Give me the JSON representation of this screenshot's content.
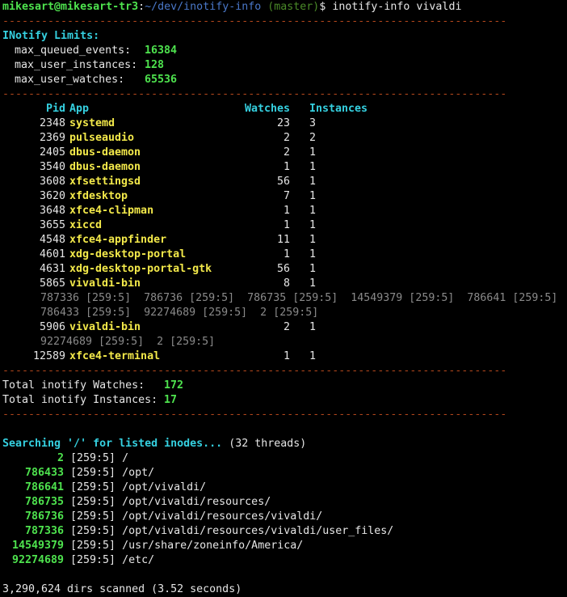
{
  "prompt": {
    "user_host": "mikesart@mikesart-tr3",
    "colon": ":",
    "cwd": "~/dev/inotify-info",
    "branch": "(master)",
    "symbol": "$",
    "command": "inotify-info vivaldi"
  },
  "separator": "------------------------------------------------------------------------------",
  "limits": {
    "title": "INotify Limits:",
    "items": [
      {
        "label": "max_queued_events:",
        "value": "16384"
      },
      {
        "label": "max_user_instances:",
        "value": "128"
      },
      {
        "label": "max_user_watches:",
        "value": "65536"
      }
    ]
  },
  "table": {
    "headers": {
      "pid": "Pid",
      "app": "App",
      "watches": "Watches",
      "instances": "Instances"
    },
    "rows": [
      {
        "pid": "2348",
        "app": "systemd",
        "watches": "23",
        "instances": "3"
      },
      {
        "pid": "2369",
        "app": "pulseaudio",
        "watches": "2",
        "instances": "2"
      },
      {
        "pid": "2405",
        "app": "dbus-daemon",
        "watches": "2",
        "instances": "1"
      },
      {
        "pid": "3540",
        "app": "dbus-daemon",
        "watches": "1",
        "instances": "1"
      },
      {
        "pid": "3608",
        "app": "xfsettingsd",
        "watches": "56",
        "instances": "1"
      },
      {
        "pid": "3620",
        "app": "xfdesktop",
        "watches": "7",
        "instances": "1"
      },
      {
        "pid": "3648",
        "app": "xfce4-clipman",
        "watches": "1",
        "instances": "1"
      },
      {
        "pid": "3655",
        "app": "xiccd",
        "watches": "1",
        "instances": "1"
      },
      {
        "pid": "4548",
        "app": "xfce4-appfinder",
        "watches": "11",
        "instances": "1"
      },
      {
        "pid": "4601",
        "app": "xdg-desktop-portal",
        "watches": "1",
        "instances": "1"
      },
      {
        "pid": "4631",
        "app": "xdg-desktop-portal-gtk",
        "watches": "56",
        "instances": "1"
      },
      {
        "pid": "5865",
        "app": "vivaldi-bin",
        "watches": "8",
        "instances": "1"
      }
    ],
    "vivaldi1_inodes_line1": "787336 [259:5]  786736 [259:5]  786735 [259:5]  14549379 [259:5]  786641 [259:5]",
    "vivaldi1_inodes_line2": "786433 [259:5]  92274689 [259:5]  2 [259:5]",
    "row_5906": {
      "pid": "5906",
      "app": "vivaldi-bin",
      "watches": "2",
      "instances": "1"
    },
    "vivaldi2_inodes_line": "92274689 [259:5]  2 [259:5]",
    "row_12589": {
      "pid": "12589",
      "app": "xfce4-terminal",
      "watches": "1",
      "instances": "1"
    }
  },
  "totals": {
    "watches_label": "Total inotify Watches:",
    "watches_value": "172",
    "instances_label": "Total inotify Instances:",
    "instances_value": "17"
  },
  "search": {
    "title": "Searching '/' for listed inodes...",
    "threads": "(32 threads)",
    "results": [
      {
        "inode": "2",
        "dev": "[259:5]",
        "path": "/"
      },
      {
        "inode": "786433",
        "dev": "[259:5]",
        "path": "/opt/"
      },
      {
        "inode": "786641",
        "dev": "[259:5]",
        "path": "/opt/vivaldi/"
      },
      {
        "inode": "786735",
        "dev": "[259:5]",
        "path": "/opt/vivaldi/resources/"
      },
      {
        "inode": "786736",
        "dev": "[259:5]",
        "path": "/opt/vivaldi/resources/vivaldi/"
      },
      {
        "inode": "787336",
        "dev": "[259:5]",
        "path": "/opt/vivaldi/resources/vivaldi/user_files/"
      },
      {
        "inode": "14549379",
        "dev": "[259:5]",
        "path": "/usr/share/zoneinfo/America/"
      },
      {
        "inode": "92274689",
        "dev": "[259:5]",
        "path": "/etc/"
      }
    ],
    "summary": "3,290,624 dirs scanned (3.52 seconds)"
  }
}
